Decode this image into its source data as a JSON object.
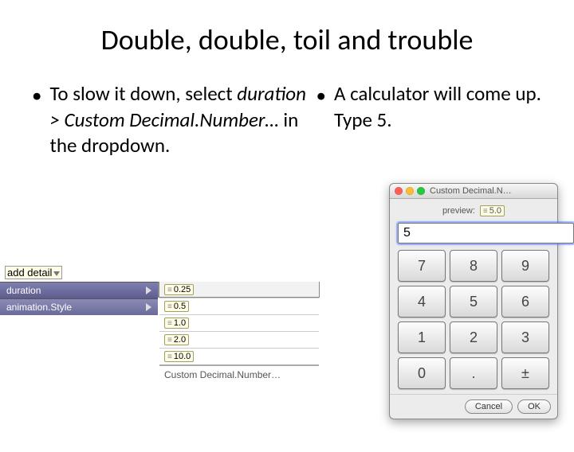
{
  "title": "Double, double, toil and trouble",
  "left_bullet": {
    "pre": "To slow it down, select ",
    "em": "duration > Custom Decimal.Number…",
    "post": " in the dropdown."
  },
  "right_bullet": "A calculator will come up.  Type 5.",
  "alice": {
    "add_detail": "add detail",
    "props": [
      "duration",
      "animation.Style"
    ],
    "options": [
      "0.25",
      "0.5",
      "1.0",
      "2.0",
      "10.0"
    ],
    "custom": "Custom Decimal.Number…"
  },
  "calc": {
    "window_title": "Custom Decimal.N…",
    "preview_label": "preview:",
    "preview_value": "5.0",
    "input_value": "5",
    "back": "←",
    "keys": [
      "7",
      "8",
      "9",
      "4",
      "5",
      "6",
      "1",
      "2",
      "3",
      "0",
      ".",
      "±"
    ],
    "cancel": "Cancel",
    "ok": "OK"
  }
}
